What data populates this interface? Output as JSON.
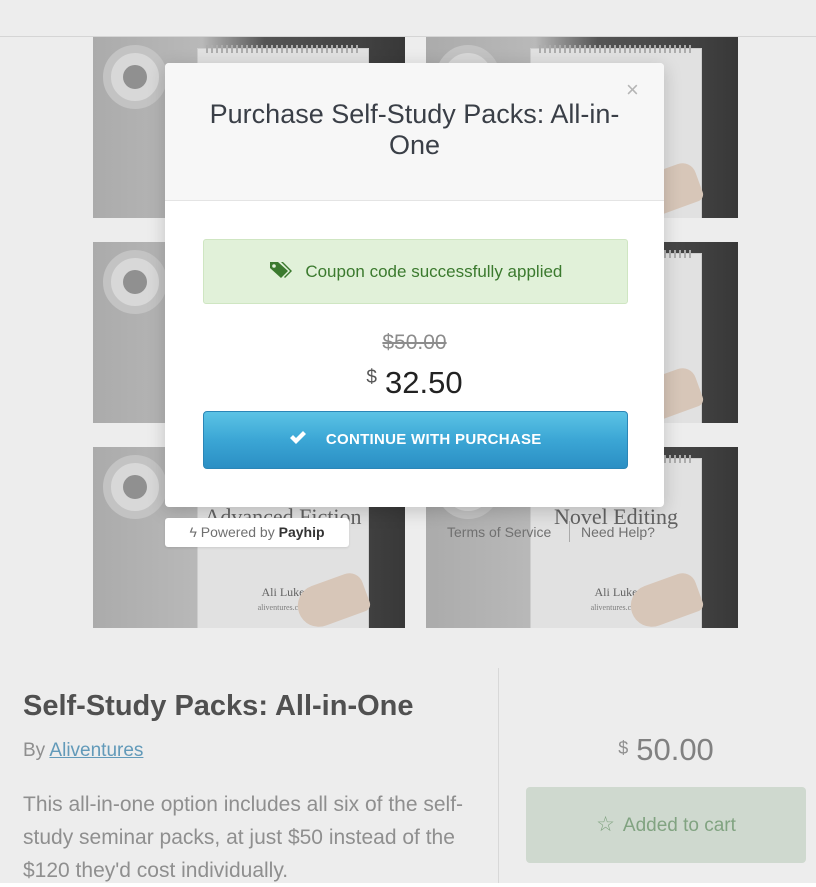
{
  "modal": {
    "title": "Purchase Self-Study Packs: All-in-One",
    "close_label": "×",
    "coupon_message": "Coupon code successfully applied",
    "original_price": "$50.00",
    "currency_symbol": "$",
    "discounted_price": "32.50",
    "cta_label": "CONTINUE WITH PURCHASE"
  },
  "footer": {
    "powered_prefix": "Powered by",
    "powered_brand": "Payhip",
    "terms": "Terms of Service",
    "help": "Need Help?"
  },
  "gallery": [
    {
      "title": "",
      "author": "",
      "site": ""
    },
    {
      "title": "",
      "author": "",
      "site": ""
    },
    {
      "title": "",
      "author": "",
      "site": ""
    },
    {
      "title": "",
      "author": "",
      "site": ""
    },
    {
      "title": "Advanced Fiction",
      "author": "Ali Luke",
      "site": "aliventures.com"
    },
    {
      "title": "Novel Editing",
      "author": "Ali Luke",
      "site": "aliventures.com"
    }
  ],
  "product": {
    "title": "Self-Study Packs: All-in-One",
    "by_prefix": "By",
    "author": "Aliventures",
    "description": "This all-in-one option includes all six of the self-study seminar packs, at just $50 instead of the $120 they'd cost individually.",
    "currency_symbol": "$",
    "price": "50.00",
    "cart_label": "Added to cart"
  },
  "colors": {
    "coupon_bg": "#e1f1d9",
    "coupon_text": "#3b7a2e",
    "cta_top": "#5bc3e5",
    "cta_bottom": "#2b8fc4"
  },
  "icons": {
    "close": "close-icon",
    "coupon": "tag-icon",
    "cta": "checkmark-icon",
    "powered": "bolt-icon",
    "cart": "star-icon"
  }
}
